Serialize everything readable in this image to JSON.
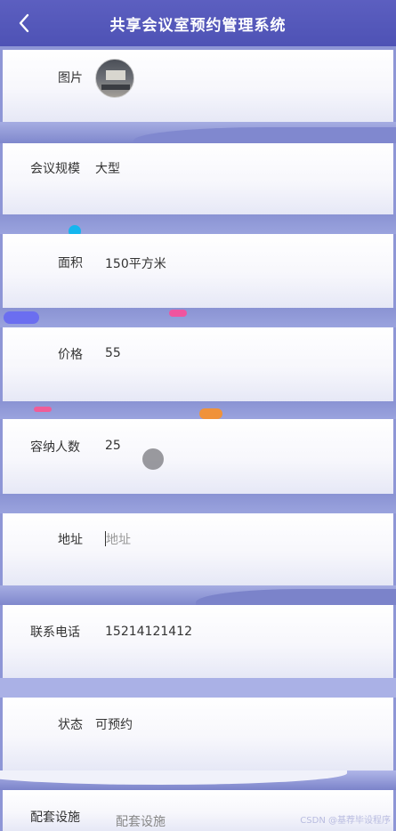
{
  "header": {
    "title": "共享会议室预约管理系统"
  },
  "form": {
    "image_label": "图片",
    "scale_label": "会议规模",
    "scale_value": "大型",
    "area_label": "面积",
    "area_value": "150平方米",
    "price_label": "价格",
    "price_value": "55",
    "capacity_label": "容纳人数",
    "capacity_value": "25",
    "address_label": "地址",
    "address_placeholder": "地址",
    "phone_label": "联系电话",
    "phone_value": "15214121412",
    "status_label": "状态",
    "status_value": "可预约",
    "facilities_label": "配套设施",
    "facilities_placeholder": "配套设施"
  },
  "watermark": "CSDN @基荐毕设程序",
  "icons": {
    "back": "chevron-left-icon"
  }
}
